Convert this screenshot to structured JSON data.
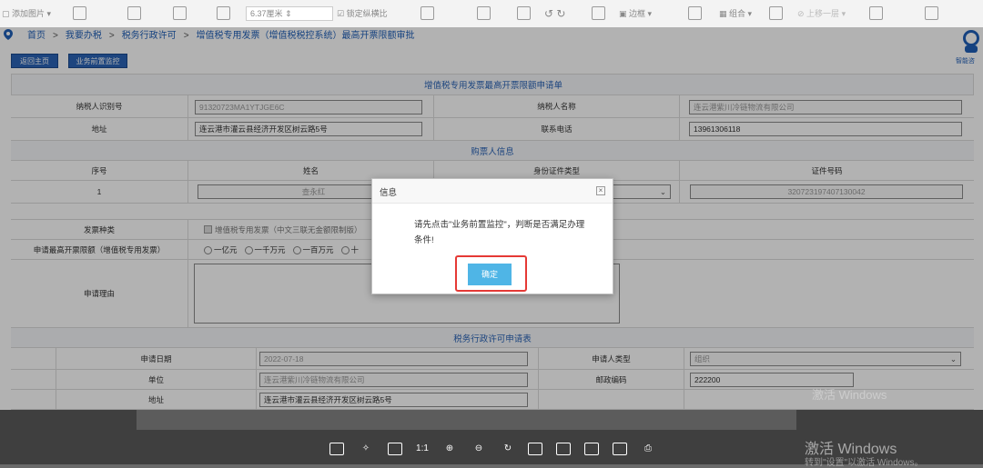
{
  "toolbar": {
    "add_image": "添加图片",
    "size_value": "6.37厘米",
    "lock_ratio": "锁定纵横比",
    "border": "边框",
    "combine": "组合",
    "move_up": "上移一层"
  },
  "breadcrumb": {
    "home": "首页",
    "b1": "我要办税",
    "b2": "税务行政许可",
    "b3": "增值税专用发票（增值税税控系统）最高开票限额审批",
    "sep": ">"
  },
  "help": {
    "label": "智能咨"
  },
  "buttons": {
    "back_home": "返回主页",
    "pre_monitor": "业务前置监控"
  },
  "form": {
    "title": "增值税专用发票最高开票限额申请单",
    "taxpayer_id_label": "纳税人识别号",
    "taxpayer_id": "91320723MA1YTJGE6C",
    "taxpayer_name_label": "纳税人名称",
    "taxpayer_name": "连云港紫川冷链物流有限公司",
    "address_label": "地址",
    "address": "连云港市灌云县经济开发区树云路5号",
    "phone_label": "联系电话",
    "phone": "13961306118",
    "buyer_info": "购票人信息",
    "col_no": "序号",
    "col_name": "姓名",
    "col_id_type": "身份证件类型",
    "col_id_no": "证件号码",
    "row_no": "1",
    "row_name": "查永红",
    "row_id_no": "320723197407130042",
    "invoice_type_label": "发票种类",
    "invoice_type": "增值税专用发票（中文三联无金额限制版）",
    "max_limit_label": "申请最高开票限额（增值税专用发票）",
    "limit_options": [
      "一亿元",
      "一千万元",
      "一百万元",
      "十"
    ],
    "reason_label": "申请理由"
  },
  "permit": {
    "title": "税务行政许可申请表",
    "apply_date_label": "申请日期",
    "apply_date": "2022-07-18",
    "applicant_type_label": "申请人类型",
    "applicant_type": "组织",
    "unit_label": "单位",
    "unit": "连云港紫川冷链物流有限公司",
    "postcode_label": "邮政编码",
    "postcode": "222200",
    "addr_label": "地址",
    "addr": "连云港市灌云县经济开发区树云路5号"
  },
  "dialog": {
    "title": "信息",
    "close": "×",
    "message": "请先点击\"业务前置监控\"，判断是否满足办理条件!",
    "ok": "确定"
  },
  "viewer": {
    "ratio": "1:1"
  },
  "watermark": {
    "line1": "激活 Windows",
    "line2": "转到\"设置\"以激活 Windows。",
    "bg": "激活 Windows"
  },
  "colors": {
    "primary": "#2a64b6",
    "ok_button": "#4fb5e6",
    "highlight": "#e53935"
  }
}
